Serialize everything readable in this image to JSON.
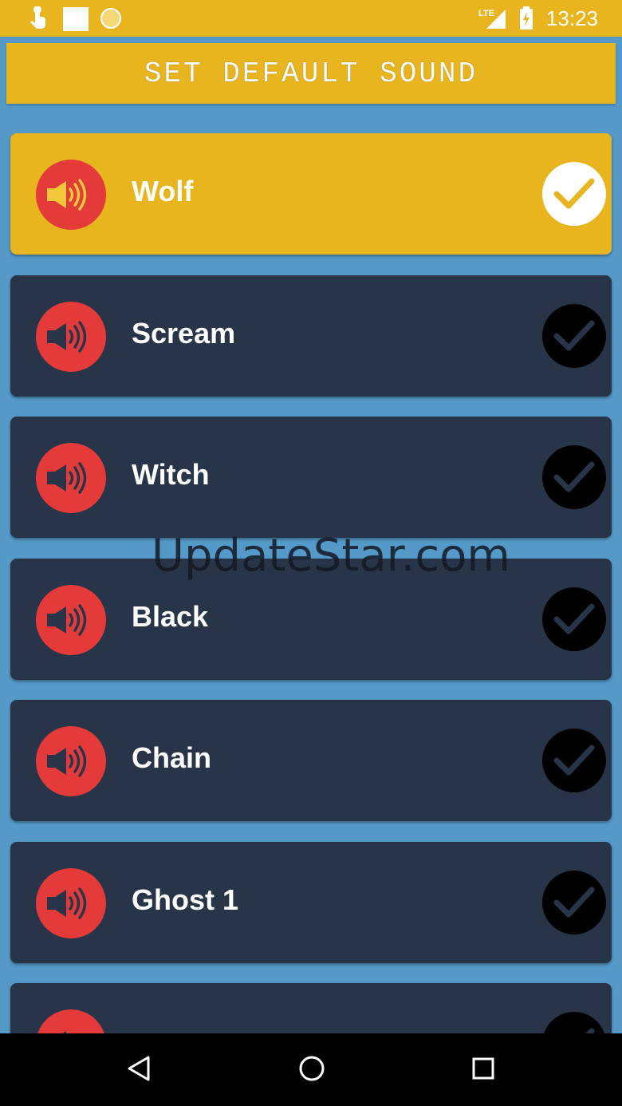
{
  "status_bar": {
    "time": "13:23",
    "network": "LTE",
    "icons": [
      "touch-app-icon",
      "white-square-icon",
      "circle-notification-icon",
      "lte-signal-icon",
      "battery-charging-icon"
    ]
  },
  "header": {
    "title": "SET DEFAULT SOUND"
  },
  "sounds": [
    {
      "label": "Wolf",
      "selected": true
    },
    {
      "label": "Scream",
      "selected": false
    },
    {
      "label": "Witch",
      "selected": false
    },
    {
      "label": "Black",
      "selected": false
    },
    {
      "label": "Chain",
      "selected": false
    },
    {
      "label": "Ghost 1",
      "selected": false
    },
    {
      "label": "",
      "selected": false
    }
  ],
  "watermark": "UpdateStar.com",
  "nav_bar": {
    "buttons": [
      "back-icon",
      "home-icon",
      "recents-icon"
    ]
  },
  "colors": {
    "accent": "#E8B51E",
    "background": "#5599C8",
    "card": "#283548",
    "speaker": "#E53A3A"
  }
}
